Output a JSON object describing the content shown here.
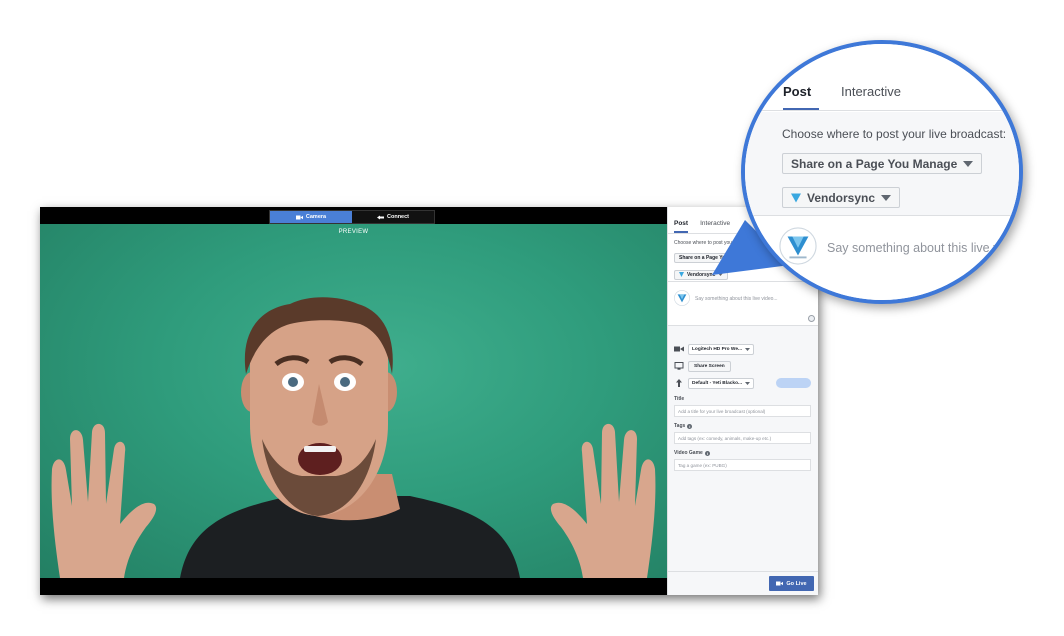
{
  "toolbar": {
    "camera_label": "Camera",
    "connect_label": "Connect"
  },
  "preview": {
    "label": "PREVIEW"
  },
  "sidebar": {
    "tabs": [
      {
        "label": "Post",
        "active": true
      },
      {
        "label": "Interactive",
        "active": false
      }
    ],
    "choose_where": "Choose where to post your live broadcast:",
    "share_target": "Share on a Page You Manage",
    "page_name": "Vendorsync",
    "say_placeholder": "Say something about this live video...",
    "devices": {
      "camera": "Logitech HD Pro We...",
      "share_screen": "Share Screen",
      "microphone": "Default - Yeti Blacko..."
    },
    "fields": {
      "title_label": "Title",
      "title_placeholder": "Add a title for your live broadcast (optional)",
      "tags_label": "Tags",
      "tags_placeholder": "Add tags (ex: comedy, animals, make-up etc.)",
      "game_label": "Video Game",
      "game_placeholder": "Tag a game (ex: PUBG)"
    },
    "go_live_label": "Go Live"
  },
  "zoom": {
    "tab_post": "Post",
    "tab_interactive": "Interactive",
    "choose_where": "Choose where to post your live broadcast:",
    "share_target": "Share on a Page You Manage",
    "page_name": "Vendorsync",
    "say_text": "Say something about this live vi"
  },
  "colors": {
    "accent": "#4267b2",
    "camera_button": "#4a7fd6",
    "zoom_ring": "#3e78d8",
    "green_screen": "#2f9c7c"
  }
}
